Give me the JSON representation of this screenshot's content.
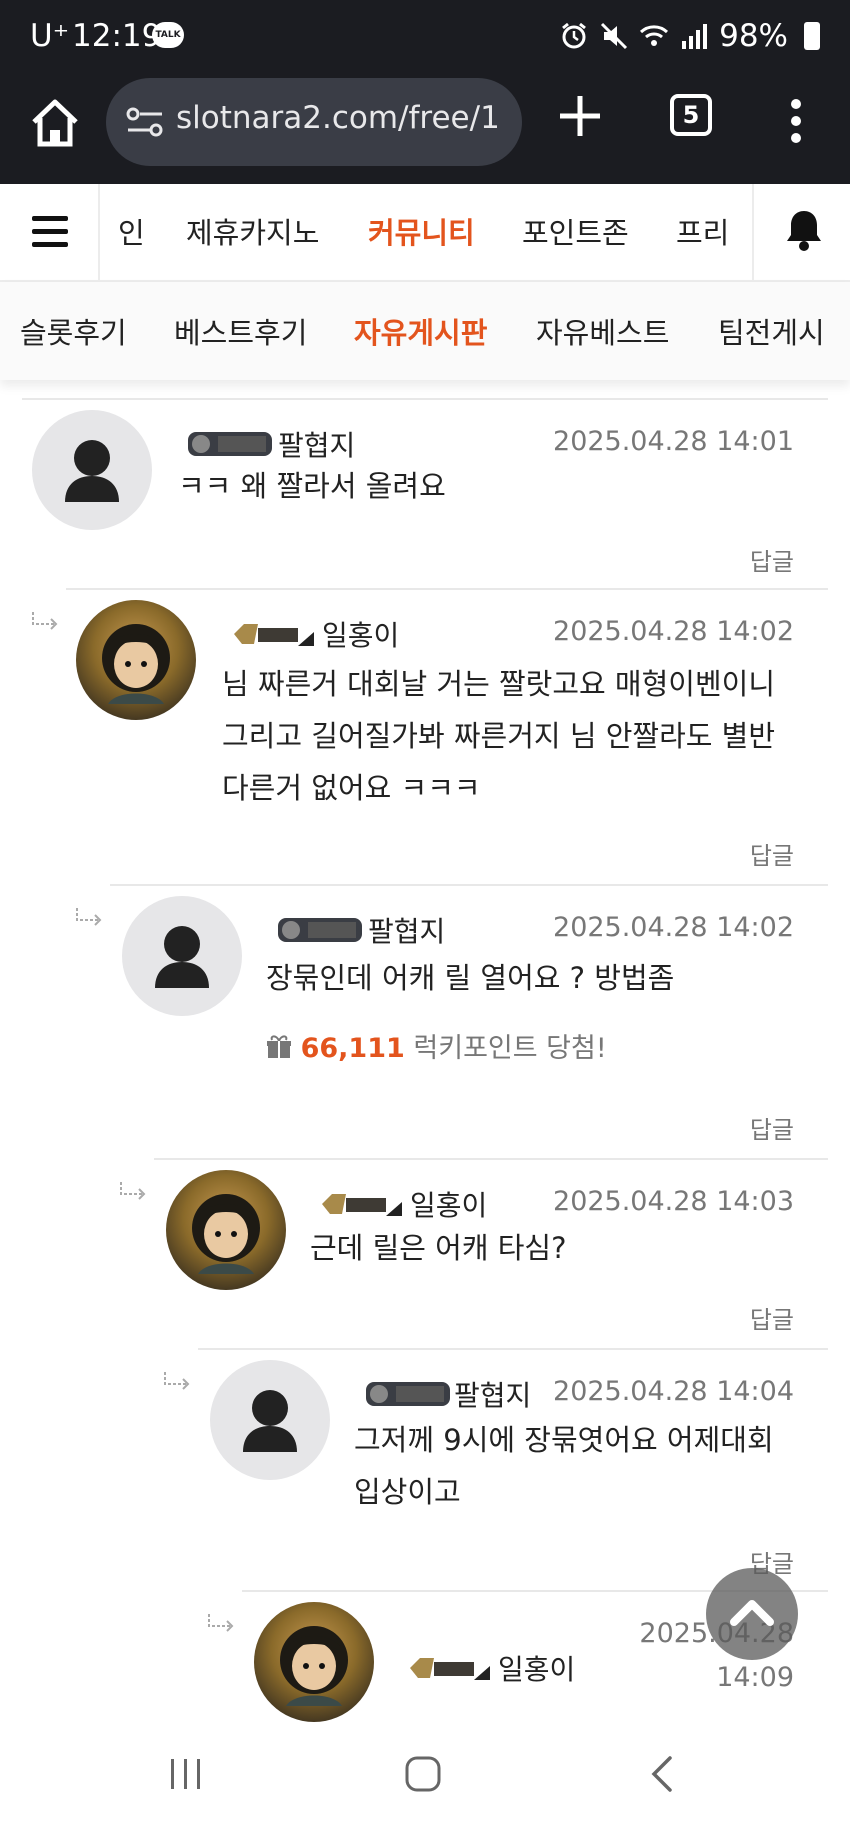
{
  "status_bar": {
    "carrier": "U⁺",
    "time": "12:19",
    "talk_label": "TALK",
    "battery": "98%"
  },
  "browser": {
    "url": "slotnara2.com/free/1",
    "tab_count": "5"
  },
  "main_nav": {
    "items": [
      "인",
      "제휴카지노",
      "커뮤니티",
      "포인트존",
      "프리"
    ],
    "active": "커뮤니티"
  },
  "sub_nav": {
    "items": [
      "슬롯후기",
      "베스트후기",
      "자유게시판",
      "자유베스트",
      "팀전게시"
    ],
    "active": "자유게시판"
  },
  "comments": [
    {
      "nick": "팔협지",
      "date": "2025.04.28 14:01",
      "lines": [
        "ㅋㅋ 왜 짤라서 올려요"
      ],
      "reply": "답글"
    },
    {
      "nick": "일홍이",
      "date": "2025.04.28 14:02",
      "lines": [
        "님 짜른거 대회날 거는 짤랏고요 매형이벤이니",
        "그리고 길어질가봐 짜른거지 님 안짤라도 별반",
        "다른거 없어요 ㅋㅋㅋ"
      ],
      "reply": "답글"
    },
    {
      "nick": "팔협지",
      "date": "2025.04.28 14:02",
      "lines": [
        "장묶인데 어캐 릴 열어요 ? 방법좀"
      ],
      "lucky_amount": "66,111",
      "lucky_text": "럭키포인트 당첨!",
      "reply": "답글"
    },
    {
      "nick": "일홍이",
      "date": "2025.04.28 14:03",
      "lines": [
        "근데 릴은 어캐 타심?"
      ],
      "reply": "답글"
    },
    {
      "nick": "팔협지",
      "date": "2025.04.28 14:04",
      "lines": [
        "그저께 9시에 장묶엿어요 어제대회",
        "입상이고"
      ],
      "reply": "답글"
    },
    {
      "nick": "일홍이",
      "date_line1": "2025.04.28",
      "date_line2": "14:09"
    }
  ],
  "colors": {
    "accent": "#e3541d",
    "dark_bar": "#1b1c21"
  }
}
